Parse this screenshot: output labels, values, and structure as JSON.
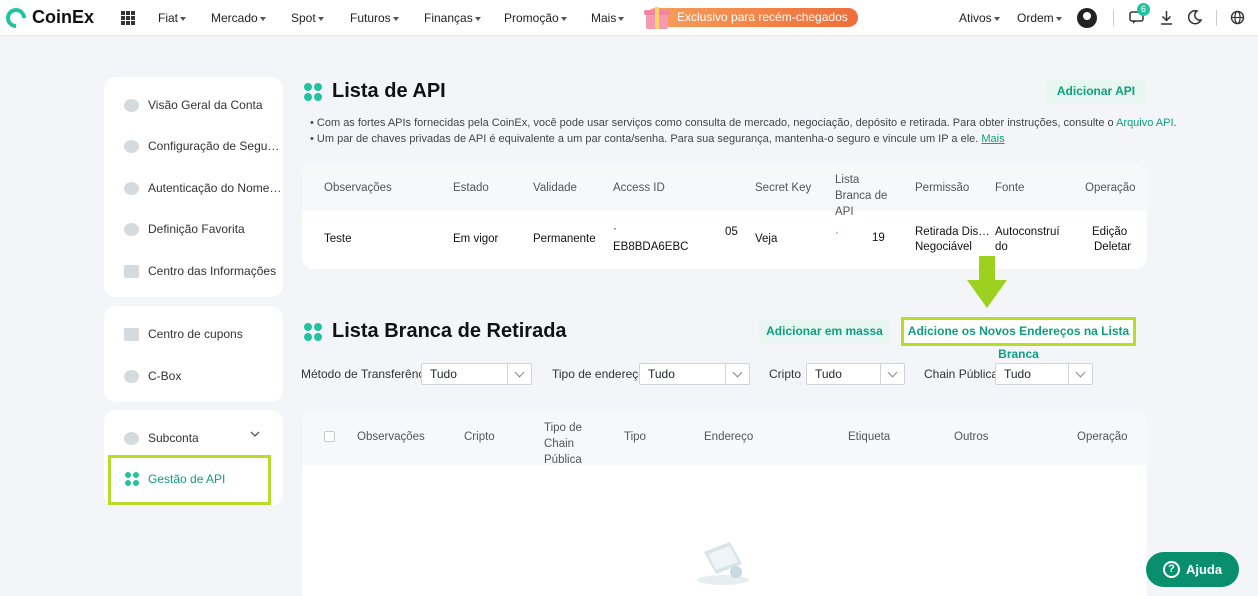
{
  "brand": "CoinEx",
  "nav": {
    "items": [
      "Fiat",
      "Mercado",
      "Spot",
      "Futuros",
      "Finanças",
      "Promoção",
      "Mais"
    ],
    "promo": "Exclusivo para recém-chegados",
    "right": [
      "Ativos",
      "Ordem"
    ],
    "notif_count": "6"
  },
  "sidebar": {
    "group1": [
      "Visão Geral da Conta",
      "Configuração de Segu…",
      "Autenticação do Nome…",
      "Definição Favorita",
      "Centro das Informações"
    ],
    "group2": [
      "Centro de cupons",
      "C-Box"
    ],
    "group3": [
      "Subconta",
      "Gestão de API"
    ]
  },
  "api": {
    "title": "Lista de API",
    "add_button": "Adicionar API",
    "note1": "• Com as fortes APIs fornecidas pela CoinEx, você pode usar serviços como consulta de mercado, negociação, depósito e retirada. Para obter instruções, consulte o ",
    "note1_link": "Arquivo API",
    "note1_end": ".",
    "note2": "• Um par de chaves privadas de API é equivalente a um par conta/senha. Para sua segurança, mantenha-o seguro e vincule um IP a ele. ",
    "note2_link": "Mais",
    "columns": [
      "Observações",
      "Estado",
      "Validade",
      "Access ID",
      "Secret Key",
      "Lista Branca de API",
      "Permissão",
      "Fonte",
      "Operação"
    ],
    "row": {
      "obs": "Teste",
      "estado": "Em vigor",
      "validade": "Permanente",
      "access_top": "·",
      "access_suffix": "05",
      "access_id": "EB8BDA6EBC",
      "secret": "Veja",
      "wl_dot": "·",
      "wl_count": "19",
      "permissao1": "Retirada Dis…",
      "permissao2": "Negociável",
      "fonte1": "Autoconstruí",
      "fonte2": "do",
      "op_edit": "Edição",
      "op_delete": "Deletar"
    }
  },
  "whitelist": {
    "title": "Lista Branca de Retirada",
    "bulk_button": "Adicionar em massa",
    "add_button": "Adicione os Novos Endereços na Lista Branca",
    "filters": [
      {
        "label": "Método de Transferência",
        "value": "Tudo"
      },
      {
        "label": "Tipo de endereço",
        "value": "Tudo"
      },
      {
        "label": "Cripto",
        "value": "Tudo"
      },
      {
        "label": "Chain Pública",
        "value": "Tudo"
      }
    ],
    "columns": [
      "Observações",
      "Cripto",
      "Tipo de Chain Pública",
      "Tipo",
      "Endereço",
      "Etiqueta",
      "Outros",
      "Operação"
    ]
  },
  "help_button": "Ajuda",
  "colors": {
    "accent": "#22c3a1",
    "highlight": "#b9dc29",
    "link": "#0d9f7f"
  }
}
